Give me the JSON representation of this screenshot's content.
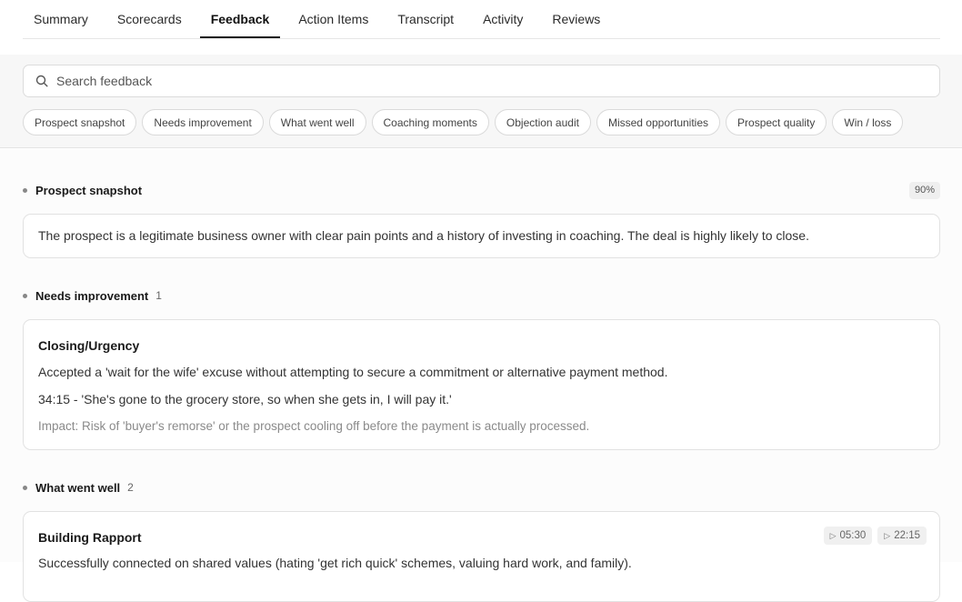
{
  "tabs": [
    {
      "label": "Summary"
    },
    {
      "label": "Scorecards"
    },
    {
      "label": "Feedback",
      "active": true
    },
    {
      "label": "Action Items"
    },
    {
      "label": "Transcript"
    },
    {
      "label": "Activity"
    },
    {
      "label": "Reviews"
    }
  ],
  "search": {
    "placeholder": "Search feedback",
    "value": ""
  },
  "chips": [
    "Prospect snapshot",
    "Needs improvement",
    "What went well",
    "Coaching moments",
    "Objection audit",
    "Missed opportunities",
    "Prospect quality",
    "Win / loss"
  ],
  "snapshot": {
    "title": "Prospect snapshot",
    "badge": "90%",
    "text": "The prospect is a legitimate business owner with clear pain points and a history of investing in coaching. The deal is highly likely to close."
  },
  "needs_improvement": {
    "title": "Needs improvement",
    "count": "1",
    "item": {
      "title": "Closing/Urgency",
      "description": "Accepted a 'wait for the wife' excuse without attempting to secure a commitment or alternative payment method.",
      "quote": "34:15 - 'She's gone to the grocery store, so when she gets in, I will pay it.'",
      "impact": "Impact: Risk of 'buyer's remorse' or the prospect cooling off before the payment is actually processed."
    }
  },
  "went_well": {
    "title": "What went well",
    "count": "2",
    "item": {
      "title": "Building Rapport",
      "timestamps": [
        "05:30",
        "22:15"
      ],
      "description": "Successfully connected on shared values (hating 'get rich quick' schemes, valuing hard work, and family)."
    }
  },
  "icons": {
    "search": "search-icon",
    "play": "play-icon",
    "bullet": "bullet-dot-icon"
  },
  "colors": {
    "active_tab_underline": "#222222",
    "filter_background": "#f7f7f7",
    "chip_border": "#dadada"
  }
}
